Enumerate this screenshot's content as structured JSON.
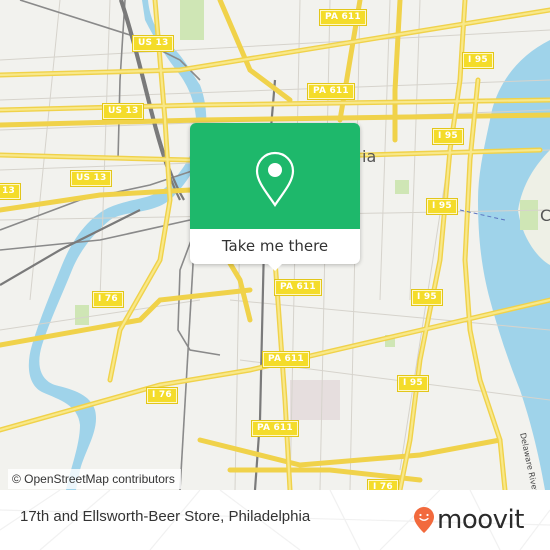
{
  "map": {
    "attribution": "© OpenStreetMap contributors",
    "city_label_fragment": "ia",
    "city_label_fragment_right": "C",
    "river_label": "Delaware River",
    "colors": {
      "land": "#f2f2ee",
      "water": "#9fd3ea",
      "park": "#cfe6b5",
      "road_major": "#f6e27a",
      "road_minor": "#d9d6cf",
      "rail": "#8a8a8a",
      "shield": "#f4dc2a"
    },
    "shields": [
      {
        "label": "US 13"
      },
      {
        "label": "US 13"
      },
      {
        "label": "US 13"
      },
      {
        "label": "13"
      },
      {
        "label": "PA 611"
      },
      {
        "label": "PA 611"
      },
      {
        "label": "PA 611"
      },
      {
        "label": "PA 611"
      },
      {
        "label": "PA 611"
      },
      {
        "label": "I 95"
      },
      {
        "label": "I 95"
      },
      {
        "label": "I 95"
      },
      {
        "label": "I 95"
      },
      {
        "label": "I 95"
      },
      {
        "label": "I 76"
      },
      {
        "label": "I 76"
      },
      {
        "label": "I 76"
      }
    ]
  },
  "popup": {
    "icon": "map-pin-icon",
    "button_label": "Take me there",
    "color": "#1eb86b"
  },
  "footer": {
    "place_title": "17th and Ellsworth-Beer Store, Philadelphia",
    "brand": "moovit",
    "brand_color": "#f26a3d"
  }
}
